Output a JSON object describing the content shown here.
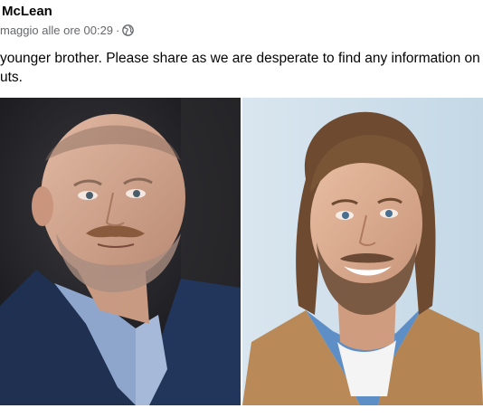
{
  "post": {
    "author": "McLean",
    "timestamp": "maggio alle ore 00:29",
    "separator": "·",
    "privacy_icon": "globe-icon",
    "text_line_1": "younger brother. Please share as we are desperate to find any information on",
    "text_line_2": "uts."
  },
  "photos": [
    {
      "subject": "photo-left"
    },
    {
      "subject": "photo-right"
    }
  ]
}
